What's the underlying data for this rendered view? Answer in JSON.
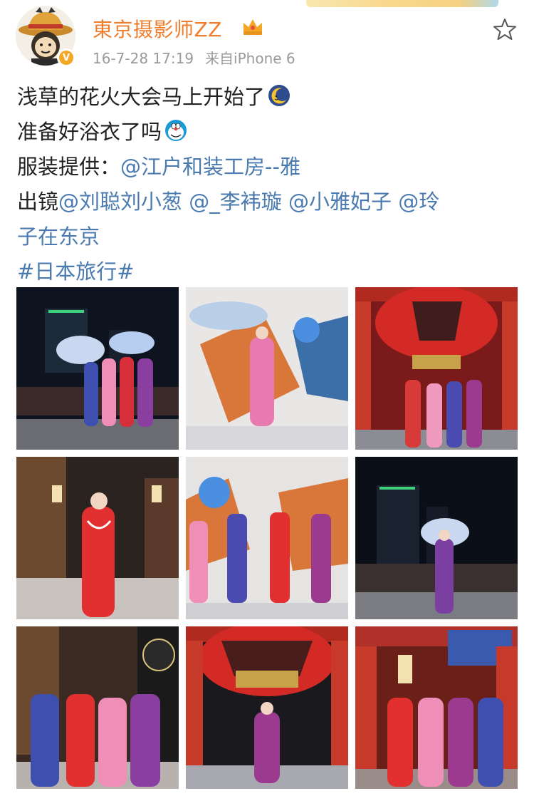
{
  "post": {
    "author": {
      "name": "東京摄影师ZZ",
      "verified_icon": "v-badge-icon",
      "member_icon": "crown-icon"
    },
    "timestamp": "16-7-28 17:19",
    "source": "来自iPhone 6",
    "favorite_icon": "star-outline-icon",
    "text": {
      "line1": "浅草的花火大会马上开始了",
      "line2": "准备好浴衣了吗",
      "line3_prefix": "服装提供：",
      "line3_mention": "@江户和装工房--雅",
      "line4_prefix": "出镜",
      "line4_mention1": "@刘聪刘小葱",
      "line4_mention2": "@_李袆璇",
      "line4_mention3": "@小雅妃子",
      "line4_mention4_a": "@玲",
      "line5_mention4_b": "子在东京",
      "hashtag": "#日本旅行#"
    },
    "emojis": [
      "moon-emoji-icon",
      "doraemon-emoji-icon"
    ]
  },
  "photos": [
    {
      "label": "photo-1"
    },
    {
      "label": "photo-2"
    },
    {
      "label": "photo-3"
    },
    {
      "label": "photo-4"
    },
    {
      "label": "photo-5"
    },
    {
      "label": "photo-6"
    },
    {
      "label": "photo-7"
    },
    {
      "label": "photo-8"
    },
    {
      "label": "photo-9"
    }
  ],
  "colors": {
    "username": "#f07d2b",
    "link": "#4a7ab0",
    "meta": "#9a9a9a",
    "badge": "#f5a623"
  }
}
